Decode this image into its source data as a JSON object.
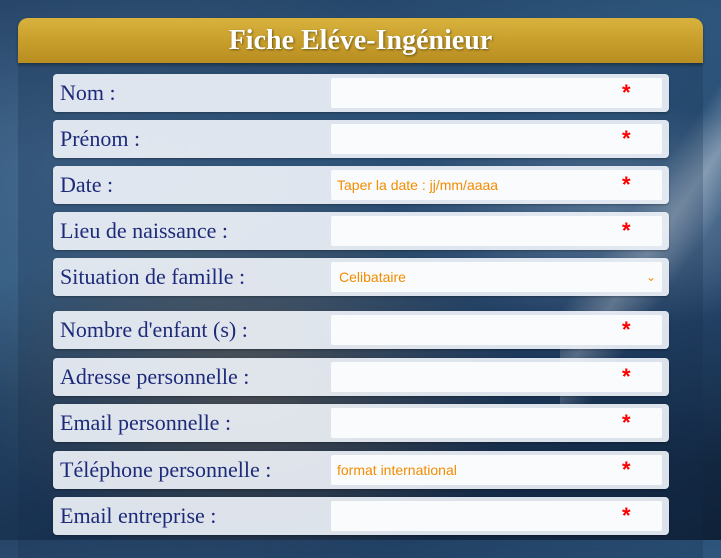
{
  "form": {
    "title": "Fiche Eléve-Ingénieur",
    "required_mark": "*",
    "fields": [
      {
        "label": "Nom :",
        "value": "",
        "placeholder": ""
      },
      {
        "label": "Prénom :",
        "value": "",
        "placeholder": ""
      },
      {
        "label": "Date :",
        "value": "",
        "placeholder": "Taper la date : jj/mm/aaaa"
      },
      {
        "label": "Lieu de naissance :",
        "value": "",
        "placeholder": ""
      },
      {
        "label": "Situation de famille :",
        "selected": "Celibataire"
      },
      {
        "label": "Nombre d'enfant (s) :",
        "value": "",
        "placeholder": ""
      },
      {
        "label": "Adresse personnelle :",
        "value": "",
        "placeholder": ""
      },
      {
        "label": "Email personnelle :",
        "value": "",
        "placeholder": ""
      },
      {
        "label": "Téléphone personnelle :",
        "value": "",
        "placeholder": "format international"
      },
      {
        "label": "Email entreprise :",
        "value": "",
        "placeholder": ""
      }
    ]
  },
  "colors": {
    "header_gold": "#c79d2a",
    "label_text": "#1d2a7a",
    "placeholder_orange": "#f28c00",
    "required_red": "#ff0000"
  },
  "icons": {
    "select_arrow": "chevron-down-icon"
  }
}
